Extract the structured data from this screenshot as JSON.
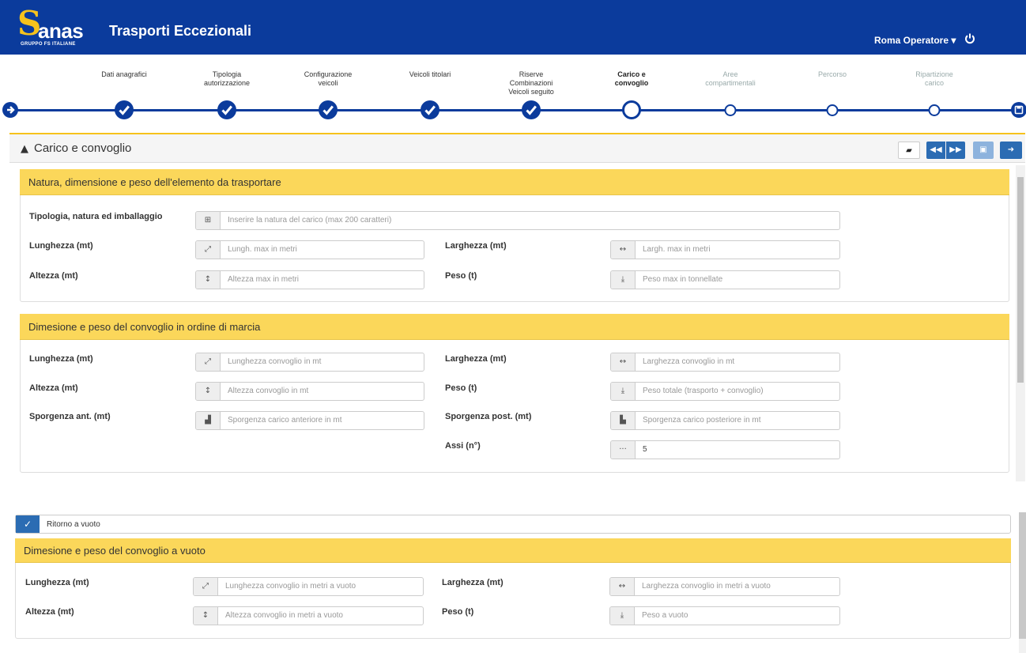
{
  "brand": {
    "logo_word": "anas",
    "logo_sub": "GRUPPO FS ITALIANE",
    "app_title": "Trasporti Eccezionali"
  },
  "header": {
    "user_menu": "Roma Operatore ▾"
  },
  "steps": [
    {
      "label": "Dati anagrafici",
      "state": "done"
    },
    {
      "label": "Tipologia autorizzazione",
      "state": "done"
    },
    {
      "label": "Configurazione veicoli",
      "state": "done"
    },
    {
      "label": "Veicoli titolari",
      "state": "done"
    },
    {
      "label": "Riserve Combinazioni Veicoli seguito",
      "state": "done"
    },
    {
      "label": "Carico e convoglio",
      "state": "current"
    },
    {
      "label": "Aree compartimentali",
      "state": "pending"
    },
    {
      "label": "Percorso",
      "state": "pending"
    },
    {
      "label": "Ripartizione carico",
      "state": "pending"
    }
  ],
  "panel": {
    "title": "Carico e convoglio"
  },
  "section1": {
    "title": "Natura, dimensione e peso dell'elemento da trasportare",
    "tipologia_label": "Tipologia, natura ed imballaggio",
    "tipologia_placeholder": "Inserire la natura del carico (max 200 caratteri)",
    "lunghezza_label": "Lunghezza (mt)",
    "lunghezza_placeholder": "Lungh. max in metri",
    "larghezza_label": "Larghezza (mt)",
    "larghezza_placeholder": "Largh. max in metri",
    "altezza_label": "Altezza (mt)",
    "altezza_placeholder": "Altezza max in metri",
    "peso_label": "Peso (t)",
    "peso_placeholder": "Peso max in tonnellate"
  },
  "section2": {
    "title": "Dimesione e peso del convoglio in ordine di marcia",
    "lunghezza_label": "Lunghezza (mt)",
    "lunghezza_placeholder": "Lunghezza convoglio in mt",
    "larghezza_label": "Larghezza (mt)",
    "larghezza_placeholder": "Larghezza convoglio in mt",
    "altezza_label": "Altezza (mt)",
    "altezza_placeholder": "Altezza convoglio in mt",
    "peso_label": "Peso (t)",
    "peso_placeholder": "Peso totale (trasporto + convoglio)",
    "sporg_ant_label": "Sporgenza ant. (mt)",
    "sporg_ant_placeholder": "Sporgenza carico anteriore in mt",
    "sporg_post_label": "Sporgenza post. (mt)",
    "sporg_post_placeholder": "Sporgenza carico posteriore in mt",
    "assi_label": "Assi (n°)",
    "assi_value": "5"
  },
  "ritorno": {
    "label": "Ritorno a vuoto",
    "checked": true
  },
  "section3": {
    "title": "Dimesione e peso del convoglio a vuoto",
    "lunghezza_label": "Lunghezza (mt)",
    "lunghezza_placeholder": "Lunghezza convoglio in metri a vuoto",
    "larghezza_label": "Larghezza (mt)",
    "larghezza_placeholder": "Larghezza convoglio in metri a vuoto",
    "altezza_label": "Altezza (mt)",
    "altezza_placeholder": "Altezza convoglio in metri a vuoto",
    "peso_label": "Peso (t)",
    "peso_placeholder": "Peso a vuoto"
  },
  "colors": {
    "brand_blue": "#0b3b9c",
    "accent_yellow": "#fbd75a",
    "button_blue": "#2b6cb3"
  },
  "icons": [
    "arrow-right-circle-icon",
    "check-icon",
    "save-icon",
    "road-icon",
    "book-icon",
    "backward-icon",
    "forward-icon",
    "sign-out-icon",
    "power-icon",
    "gift-icon",
    "resize-diagonal-icon",
    "resize-horizontal-icon",
    "resize-vertical-icon",
    "download-icon",
    "ellipsis-icon"
  ]
}
